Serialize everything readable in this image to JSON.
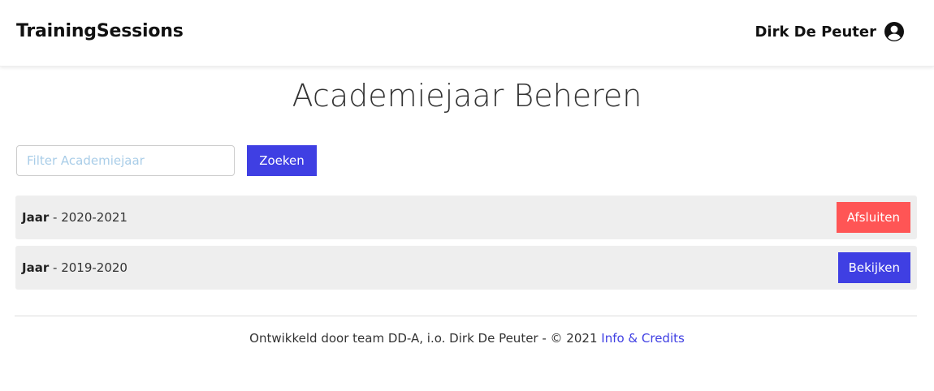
{
  "header": {
    "brand": "TrainingSessions",
    "user_name": "Dirk De Peuter",
    "user_icon": "user-circle-icon"
  },
  "main": {
    "title": "Academiejaar Beheren",
    "filter": {
      "placeholder": "Filter Academiejaar",
      "value": ""
    },
    "search_label": "Zoeken",
    "rows": [
      {
        "label": "Jaar",
        "separator": " - ",
        "year": "2020-2021",
        "action": "Afsluiten",
        "action_color": "#ff5555"
      },
      {
        "label": "Jaar",
        "separator": " - ",
        "year": "2019-2020",
        "action": "Bekijken",
        "action_color": "#3f3fe3"
      }
    ]
  },
  "footer": {
    "text": "Ontwikkeld door team DD-A, i.o. Dirk De Peuter - © 2021 ",
    "link_text": "Info & Credits"
  },
  "colors": {
    "primary": "#3f3fe3",
    "danger": "#ff5555",
    "row_background": "#eeeeee"
  }
}
